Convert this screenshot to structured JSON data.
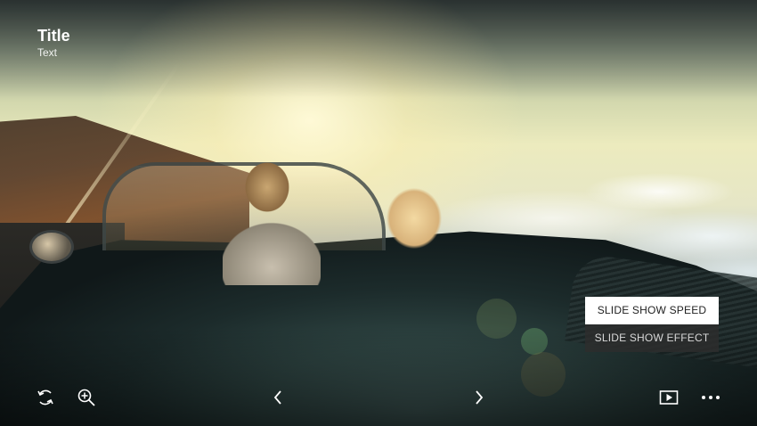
{
  "header": {
    "title": "Title",
    "subtitle": "Text"
  },
  "menu": {
    "items": [
      {
        "label": "SLIDE SHOW SPEED",
        "state": "focused"
      },
      {
        "label": "SLIDE SHOW EFFECT",
        "state": "normal"
      }
    ]
  },
  "controls": {
    "left": [
      {
        "icon": "rotate-icon"
      },
      {
        "icon": "zoom-in-icon"
      }
    ],
    "center": [
      {
        "icon": "chevron-left-icon"
      },
      {
        "icon": "chevron-right-icon"
      }
    ],
    "right": [
      {
        "icon": "slideshow-play-icon"
      },
      {
        "icon": "more-icon"
      }
    ]
  },
  "colors": {
    "menu_active_bg": "#ffffff",
    "menu_bg": "#2d2d2d",
    "icon": "#ffffff"
  }
}
